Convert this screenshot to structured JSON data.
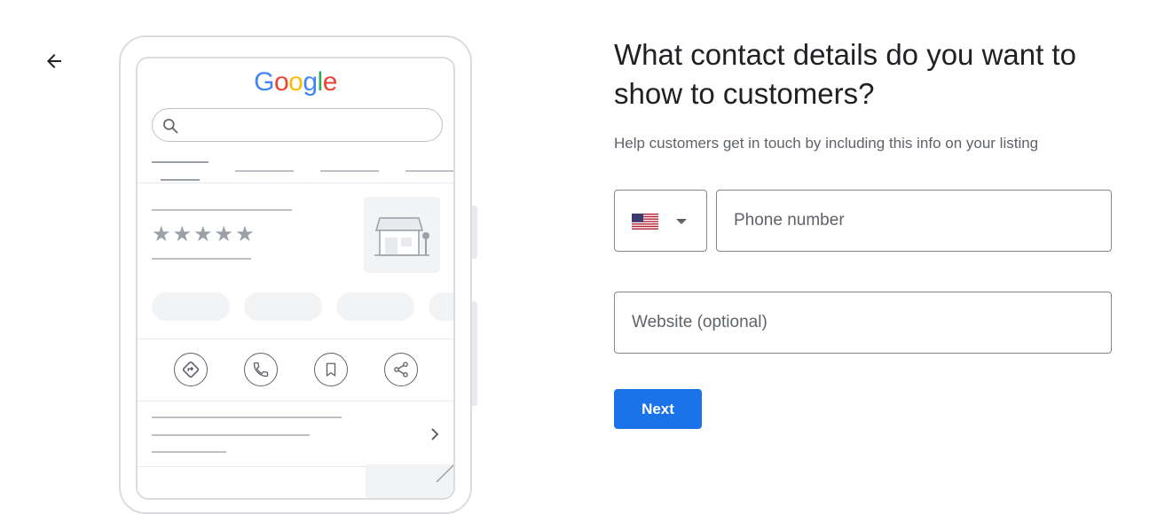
{
  "illustration": {
    "logo_letters": [
      {
        "char": "G",
        "color": "#4285F4"
      },
      {
        "char": "o",
        "color": "#EA4335"
      },
      {
        "char": "o",
        "color": "#FBBC05"
      },
      {
        "char": "g",
        "color": "#4285F4"
      },
      {
        "char": "l",
        "color": "#34A853"
      },
      {
        "char": "e",
        "color": "#EA4335"
      }
    ],
    "star_glyph": "★",
    "action_icons": [
      "directions-icon",
      "phone-icon",
      "bookmark-icon",
      "share-icon"
    ]
  },
  "form": {
    "title": "What contact details do you want to show to customers?",
    "subtitle": "Help customers get in touch by including this info on your listing",
    "country": {
      "selected_flag": "us-flag-icon"
    },
    "phone": {
      "placeholder": "Phone number",
      "value": ""
    },
    "website": {
      "placeholder": "Website (optional)",
      "value": ""
    },
    "next_label": "Next"
  },
  "colors": {
    "accent": "#1a73e8"
  }
}
